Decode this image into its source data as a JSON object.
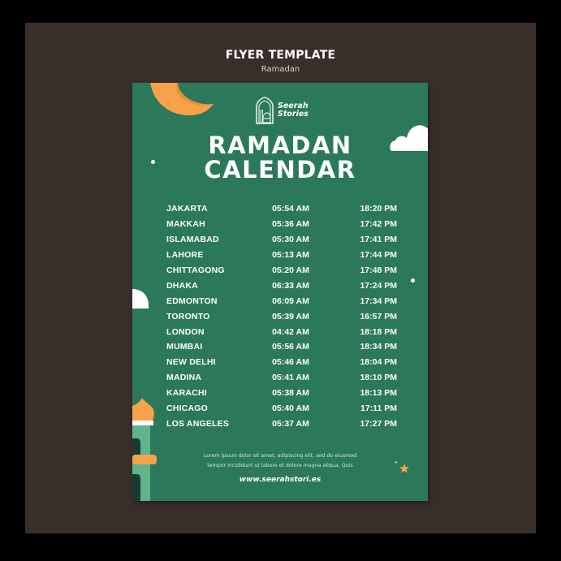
{
  "header": {
    "title": "FLYER TEMPLATE",
    "subtitle": "Ramadan"
  },
  "flyer": {
    "brand": {
      "line1": "Seerah",
      "line2": "Stories",
      "icon": "mosque-icon"
    },
    "title_line1": "RAMADAN",
    "title_line2": "CALENDAR",
    "schedule": [
      {
        "city": "JAKARTA",
        "sunrise": "05:54 AM",
        "sunset": "18:20 PM"
      },
      {
        "city": "MAKKAH",
        "sunrise": "05:36 AM",
        "sunset": "17:42 PM"
      },
      {
        "city": "ISLAMABAD",
        "sunrise": "05:30 AM",
        "sunset": "17:41 PM"
      },
      {
        "city": "LAHORE",
        "sunrise": "05:13 AM",
        "sunset": "17:44 PM"
      },
      {
        "city": "CHITTAGONG",
        "sunrise": "05:20 AM",
        "sunset": "17:48 PM"
      },
      {
        "city": "DHAKA",
        "sunrise": "06:33 AM",
        "sunset": "17:24 PM"
      },
      {
        "city": "EDMONTON",
        "sunrise": "06:09 AM",
        "sunset": "17:34 PM"
      },
      {
        "city": "TORONTO",
        "sunrise": "05:39 AM",
        "sunset": "16:57 PM"
      },
      {
        "city": "LONDON",
        "sunrise": "04:42 AM",
        "sunset": "18:18 PM"
      },
      {
        "city": "MUMBAI",
        "sunrise": "05:56 AM",
        "sunset": "18:34 PM"
      },
      {
        "city": "NEW DELHI",
        "sunrise": "05:46 AM",
        "sunset": "18:04 PM"
      },
      {
        "city": "MADINA",
        "sunrise": "05:41 AM",
        "sunset": "18:10 PM"
      },
      {
        "city": "KARACHI",
        "sunrise": "05:38 AM",
        "sunset": "18:13 PM"
      },
      {
        "city": "CHICAGO",
        "sunrise": "05:40 AM",
        "sunset": "17:11 PM"
      },
      {
        "city": "LOS ANGELES",
        "sunrise": "05:37 AM",
        "sunset": "17:27 PM"
      }
    ],
    "lorem_line1": "Lorem ipsum dolor sit amet, adipiscing elit, sed do eiusmod",
    "lorem_line2": "tempor incididunt ut labore et dolore magna aliqua. Quis",
    "website": "www.seerahstori.es"
  },
  "colors": {
    "background": "#000000",
    "panel": "#3a2e2b",
    "flyer_green": "#2b795a",
    "accent_orange": "#f7a24a",
    "minaret_green": "#5fb48c",
    "white": "#ffffff"
  }
}
